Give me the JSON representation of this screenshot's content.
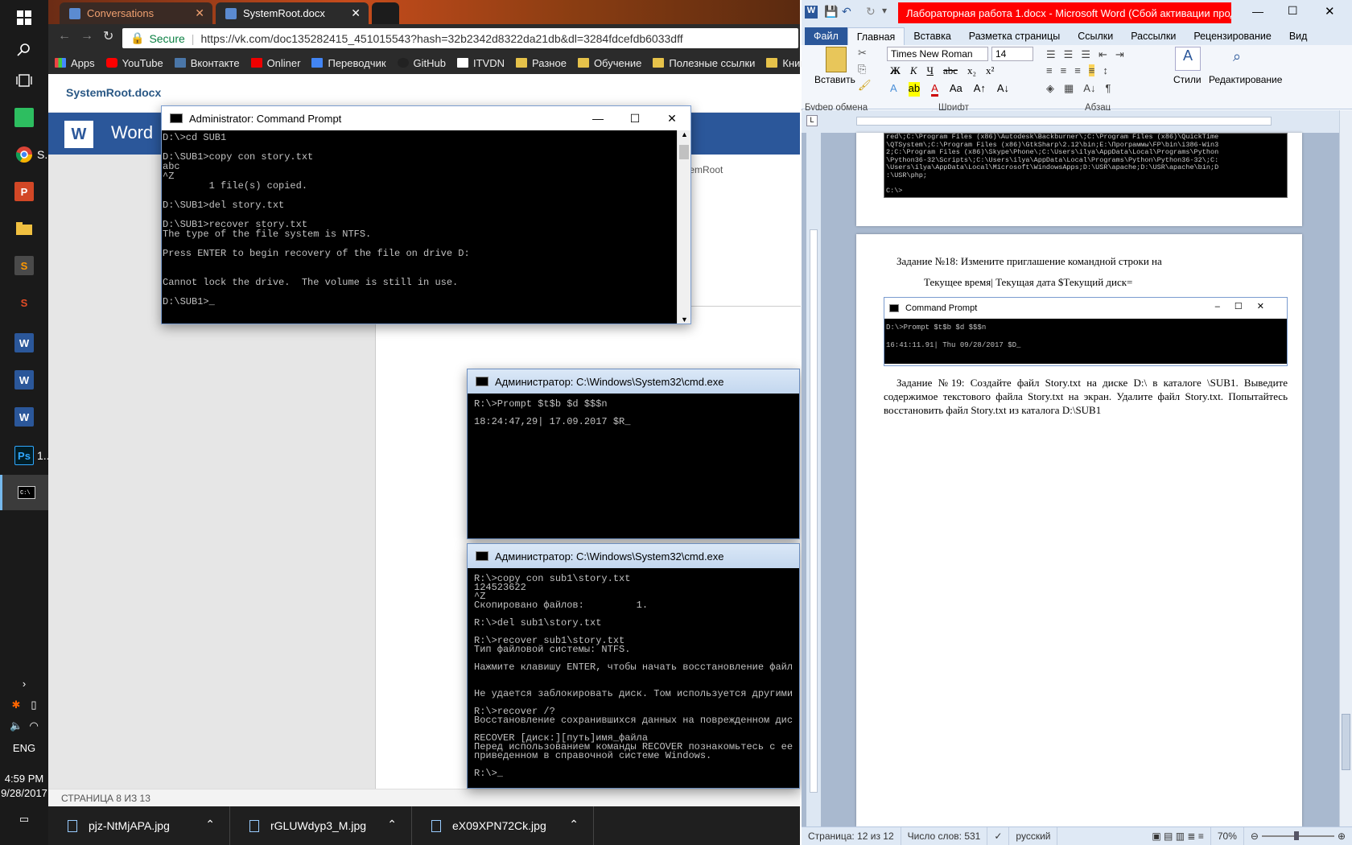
{
  "taskbar": {
    "apps": [
      {
        "label": "S...",
        "icon": "chrome-icon"
      },
      {
        "label": "1...",
        "icon": "photoshop-icon"
      }
    ],
    "lang": "ENG",
    "time": "4:59 PM",
    "date": "9/28/2017"
  },
  "chrome": {
    "tabs": [
      {
        "title": "Conversations"
      },
      {
        "title": "SystemRoot.docx"
      }
    ],
    "secure_label": "Secure",
    "url": "https://vk.com/doc135282415_451015543?hash=32b2342d8322da21db&dl=3284fdcefdb6033dff",
    "bookmarks": [
      "Apps",
      "YouTube",
      "Вконтакте",
      "Onliner",
      "Переводчик",
      "GitHub",
      "ITVDN",
      "Разное",
      "Обучение",
      "Полезные ссылки",
      "Книги"
    ]
  },
  "vk": {
    "doc_title": "SystemRoot.docx",
    "word_label": "Word",
    "side_text": "stemRoot",
    "status": "СТРАНИЦА 8 ИЗ 13"
  },
  "downloads": [
    "pjz-NtMjAPA.jpg",
    "rGLUWdyp3_M.jpg",
    "eX09XPN72Ck.jpg"
  ],
  "cmd_main": {
    "title": "Administrator: Command Prompt",
    "text": "D:\\>cd SUB1\n\nD:\\SUB1>copy con story.txt\nabc\n^Z\n        1 file(s) copied.\n\nD:\\SUB1>del story.txt\n\nD:\\SUB1>recover story.txt\nThe type of the file system is NTFS.\n\nPress ENTER to begin recovery of the file on drive D:\n\n\nCannot lock the drive.  The volume is still in use.\n\nD:\\SUB1>_"
  },
  "cmd_img1": {
    "title": "Администратор: C:\\Windows\\System32\\cmd.exe",
    "text": "R:\\>Prompt $t$b $d $$$n\n\n18:24:47,29| 17.09.2017 $R_"
  },
  "cmd_img2": {
    "title": "Администратор: C:\\Windows\\System32\\cmd.exe",
    "text": "R:\\>copy con sub1\\story.txt\n124523622\n^Z\nСкопировано файлов:         1.\n\nR:\\>del sub1\\story.txt\n\nR:\\>recover sub1\\story.txt\nТип файловой системы: NTFS.\n\nНажмите клавишу ENTER, чтобы начать восстановление файл\n\n\nНе удается заблокировать диск. Том используется другими\n\nR:\\>recover /?\nВосстановление сохранившихся данных на поврежденном дис\n\nRECOVER [диск:][путь]имя_файла\nПеред использованием команды RECOVER познакомьтесь с ее\nприведенном в справочной системе Windows.\n\nR:\\>_"
  },
  "word": {
    "title": "Лабораторная работа 1.docx - Microsoft Word (Сбой активации прод...",
    "tabs": [
      "Файл",
      "Главная",
      "Вставка",
      "Разметка страницы",
      "Ссылки",
      "Рассылки",
      "Рецензирование",
      "Вид"
    ],
    "font_name": "Times New Roman",
    "font_size": "14",
    "paste_label": "Вставить",
    "styles_label": "Стили",
    "editing_label": "Редактирование",
    "groups": [
      "Буфер обмена",
      "Шрифт",
      "Абзац"
    ],
    "top_cmd_text": "red\\;C:\\Program Files (x86)\\Autodesk\\Backburner\\;C:\\Program Files (x86)\\QuickTime\n\\QTSystem\\;C:\\Program Files (x86)\\GtkSharp\\2.12\\bin;E:\\Программы\\FP\\bin\\i386-Win3\n2;C:\\Program Files (x86)\\Skype\\Phone\\;C:\\Users\\ilya\\AppData\\Local\\Programs\\Python\n\\Python36-32\\Scripts\\;C:\\Users\\ilya\\AppData\\Local\\Programs\\Python\\Python36-32\\;C:\n\\Users\\ilya\\AppData\\Local\\Microsoft\\WindowsApps;D:\\USR\\apache;D:\\USR\\apache\\bin;D\n:\\USR\\php;\n\nC:\\>",
    "task18": "Задание №18: Измените приглашение командной строки на",
    "task18_sub": "Текущее время| Текущая дата $Текущий диск=",
    "inner_cmd_title": "Command Prompt",
    "inner_cmd_text": "D:\\>Prompt $t$b $d $$$n\n\n16:41:11.91| Thu 09/28/2017 $D_",
    "task19": "Задание №19: Создайте файл Story.txt  на диске D:\\ в каталоге \\SUB1. Выведите содержимое текстового файла Story.txt  на экран. Удалите файл Story.txt. Попытайтесь восстановить файл Story.txt из каталога D:\\SUB1",
    "status_page": "Страница: 12 из 12",
    "status_words": "Число слов: 531",
    "status_lang": "русский",
    "zoom": "70%"
  }
}
